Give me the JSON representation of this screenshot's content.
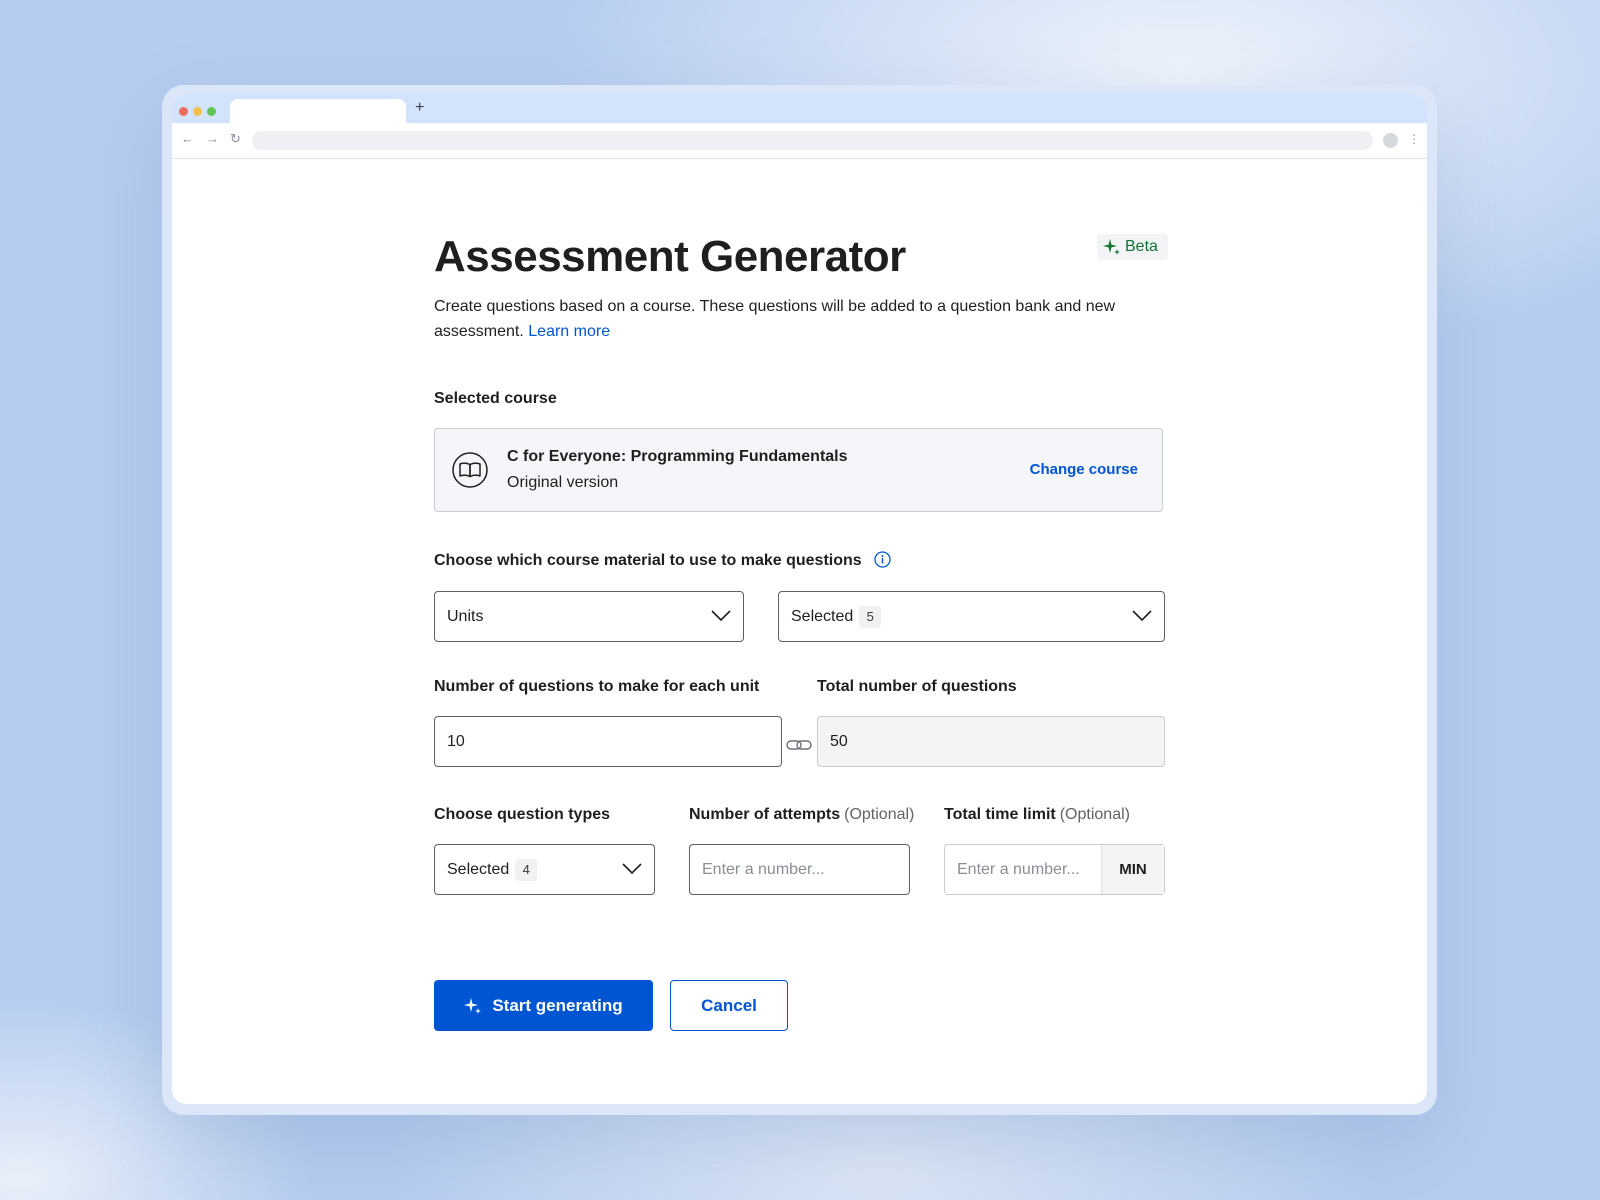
{
  "browser": {
    "new_tab": "+",
    "nav": {
      "back": "←",
      "forward": "→",
      "reload": "↻",
      "menu": "⋮"
    }
  },
  "page": {
    "title": "Assessment Generator",
    "badge": {
      "label": "Beta",
      "icon": "sparkle-icon",
      "color": "#137333"
    },
    "description": "Create questions based on a course. These questions will be added to a question bank and new assessment. ",
    "learn_more": "Learn more"
  },
  "selected_course": {
    "label": "Selected course",
    "title": "C for Everyone: Programming Fundamentals",
    "version": "Original version",
    "change_label": "Change course",
    "icon": "book-icon"
  },
  "material": {
    "label": "Choose which course material to use to make questions",
    "info_icon": "info-icon",
    "type_select": {
      "value": "Units"
    },
    "selection_select": {
      "value": "Selected",
      "count": "5"
    }
  },
  "questions": {
    "per_unit_label": "Number of questions to make for each unit",
    "per_unit_value": "10",
    "total_label": "Total number of questions",
    "total_value": "50"
  },
  "question_types": {
    "label": "Choose question types",
    "value": "Selected",
    "count": "4"
  },
  "attempts": {
    "label": "Number of attempts",
    "optional": "(Optional)",
    "placeholder": "Enter a number..."
  },
  "time_limit": {
    "label": "Total time limit",
    "optional": "(Optional)",
    "placeholder": "Enter a number...",
    "unit": "MIN"
  },
  "actions": {
    "start": "Start generating",
    "cancel": "Cancel"
  },
  "colors": {
    "primary": "#0056d2",
    "beta_green": "#137333",
    "background": "#b6cdf0",
    "text": "#1f1f1f"
  }
}
